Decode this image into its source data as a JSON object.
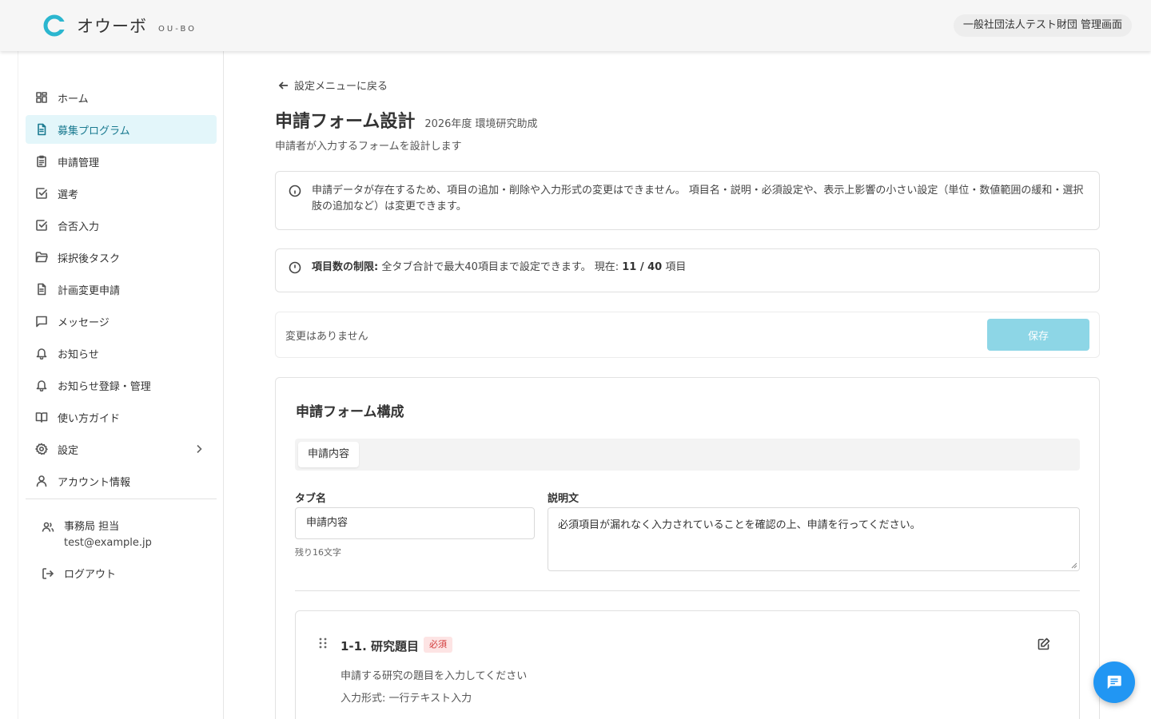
{
  "header": {
    "logo_text": "オウーボ",
    "logo_sub": "OU-BO",
    "org_badge": "一般社団法人テスト財団 管理画面"
  },
  "sidebar": {
    "items": [
      {
        "label": "ホーム",
        "icon": "dashboard-icon"
      },
      {
        "label": "募集プログラム",
        "icon": "document-icon",
        "active": true
      },
      {
        "label": "申請管理",
        "icon": "clipboard-icon"
      },
      {
        "label": "選考",
        "icon": "check-square-icon"
      },
      {
        "label": "合否入力",
        "icon": "check-square-icon"
      },
      {
        "label": "採択後タスク",
        "icon": "folder-icon"
      },
      {
        "label": "計画変更申請",
        "icon": "document-icon"
      },
      {
        "label": "メッセージ",
        "icon": "message-icon"
      },
      {
        "label": "お知らせ",
        "icon": "bell-icon"
      },
      {
        "label": "お知らせ登録・管理",
        "icon": "bell-icon"
      },
      {
        "label": "使い方ガイド",
        "icon": "book-icon"
      },
      {
        "label": "設定",
        "icon": "gear-icon"
      },
      {
        "label": "アカウント情報",
        "icon": "user-icon"
      }
    ],
    "user": {
      "name": "事務局 担当",
      "email": "test@example.jp"
    },
    "logout_label": "ログアウト"
  },
  "main": {
    "back_label": "設定メニューに戻る",
    "title": "申請フォーム設計",
    "subtitle": "2026年度 環境研究助成",
    "description": "申請者が入力するフォームを設計します",
    "alert1": "申請データが存在するため、項目の追加・削除や入力形式の変更はできません。 項目名・説明・必須設定や、表示上影響の小さい設定（単位・数値範囲の緩和・選択肢の追加など）は変更できます。",
    "alert2": {
      "label": "項目数の制限:",
      "text": " 全タブ合計で最大40項目まで設定できます。 現在: ",
      "count": "11 / 40",
      "suffix": " 項目"
    },
    "savebar": {
      "status": "変更はありません",
      "save_label": "保存"
    },
    "panel": {
      "title": "申請フォーム構成",
      "tab_label": "申請内容",
      "tab_name_label": "タブ名",
      "tab_name_value": "申請内容",
      "tab_name_hint": "残り16文字",
      "desc_label": "説明文",
      "desc_value": "必須項目が漏れなく入力されていることを確認の上、申請を行ってください。",
      "field": {
        "title": "1-1. 研究題目",
        "required_badge": "必須",
        "description": "申請する研究の題目を入力してください",
        "type": "入力形式: 一行テキスト入力"
      }
    }
  },
  "colors": {
    "accent": "#1a7a90",
    "active_bg": "#e3f6fa",
    "save_disabled": "#8dd6e6",
    "required": "#d23b3b",
    "fab": "#2196f3"
  }
}
